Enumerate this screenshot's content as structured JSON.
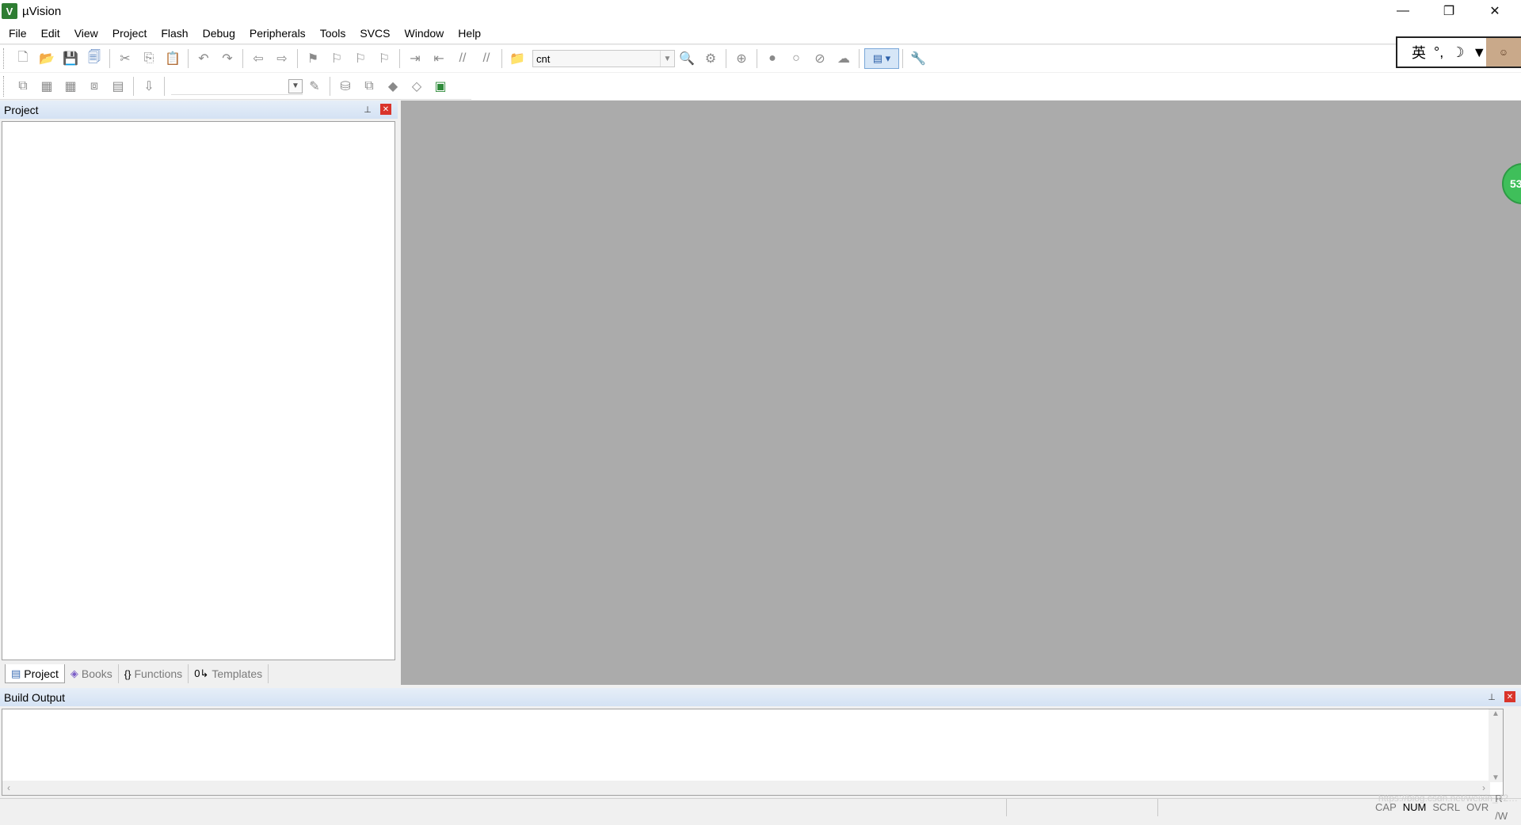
{
  "window": {
    "title": "µVision",
    "minimize": "—",
    "restore": "❐",
    "close": "✕"
  },
  "menu": [
    "File",
    "Edit",
    "View",
    "Project",
    "Flash",
    "Debug",
    "Peripherals",
    "Tools",
    "SVCS",
    "Window",
    "Help"
  ],
  "toolbar1": {
    "target_combo_value": "cnt"
  },
  "ime": {
    "lang": "英",
    "moon": "☽"
  },
  "project_panel": {
    "title": "Project",
    "tabs": [
      {
        "label": "Project",
        "icon": "project-icon",
        "glyph": "▤",
        "selected": true
      },
      {
        "label": "Books",
        "icon": "books-icon",
        "glyph": "◈",
        "selected": false
      },
      {
        "label": "Functions",
        "icon": "functions-icon",
        "glyph": "{}",
        "selected": false
      },
      {
        "label": "Templates",
        "icon": "templates-icon",
        "glyph": "0↳",
        "selected": false
      }
    ]
  },
  "floating_ball": {
    "text": "53"
  },
  "build_output": {
    "title": "Build Output"
  },
  "status_bar": {
    "flags": [
      "CAP",
      "NUM",
      "SCRL",
      "OVR",
      "R /W"
    ],
    "active": [
      "NUM"
    ]
  },
  "watermark": "https://blog.csdn.net/weixin_42…",
  "colors": {
    "editor_bg": "#ababab",
    "close_red": "#d9342b",
    "panel_header": "#d4e2f4"
  }
}
